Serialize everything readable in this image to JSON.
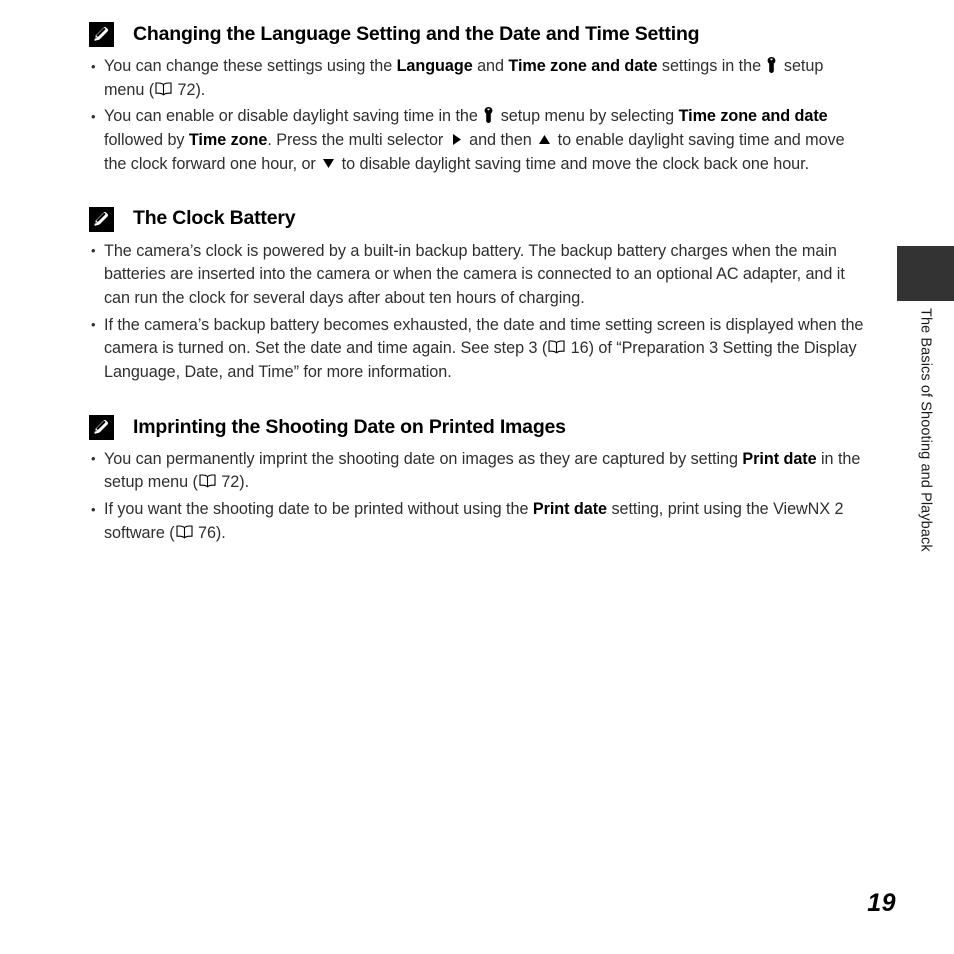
{
  "page": {
    "number": "19",
    "side_tab_label": "The Basics of Shooting and Playback"
  },
  "icons": {
    "note": "pencil-note-icon",
    "setup_menu": "wrench-icon",
    "page_reference": "open-book-icon",
    "multi_selector_right": "triangle-right-icon",
    "multi_selector_up": "triangle-up-icon",
    "multi_selector_down": "triangle-down-icon"
  },
  "sections": [
    {
      "id": "language-date-time",
      "title": "Changing the Language Setting and the Date and Time Setting",
      "bullets": [
        {
          "id": "change-settings",
          "parts": [
            {
              "t": "You can change these settings using the "
            },
            {
              "t": "Language",
              "b": true
            },
            {
              "t": " and "
            },
            {
              "t": "Time zone and date",
              "b": true
            },
            {
              "t": " settings in the "
            },
            {
              "icon": "wrench"
            },
            {
              "t": " setup menu ("
            },
            {
              "icon": "book"
            },
            {
              "t": " 72)."
            }
          ]
        },
        {
          "id": "daylight-saving",
          "parts": [
            {
              "t": "You can enable or disable daylight saving time in the "
            },
            {
              "icon": "wrench"
            },
            {
              "t": " setup menu by selecting "
            },
            {
              "t": "Time zone and date",
              "b": true
            },
            {
              "t": " followed by "
            },
            {
              "t": "Time zone",
              "b": true
            },
            {
              "t": ". Press the multi selector "
            },
            {
              "icon": "tri-right"
            },
            {
              "t": " and then "
            },
            {
              "icon": "tri-up"
            },
            {
              "t": " to enable daylight saving time and move the clock forward one hour, or "
            },
            {
              "icon": "tri-down"
            },
            {
              "t": " to disable daylight saving time and move the clock back one hour."
            }
          ]
        }
      ]
    },
    {
      "id": "clock-battery",
      "title": "The Clock Battery",
      "bullets": [
        {
          "id": "backup-battery",
          "parts": [
            {
              "t": "The camera’s clock is powered by a built-in backup battery. The backup battery charges when the main batteries are inserted into the camera or when the camera is connected to an optional AC adapter, and it can run the clock for several days after about ten hours of charging."
            }
          ]
        },
        {
          "id": "exhausted-battery",
          "parts": [
            {
              "t": "If the camera’s backup battery becomes exhausted, the date and time setting screen is displayed when the camera is turned on. Set the date and time again. See step 3 ("
            },
            {
              "icon": "book"
            },
            {
              "t": " 16) of “Preparation 3 Setting the Display Language, Date, and Time” for more information."
            }
          ]
        }
      ]
    },
    {
      "id": "imprinting-shooting-date",
      "title": "Imprinting the Shooting Date on Printed Images",
      "bullets": [
        {
          "id": "print-date-setting",
          "parts": [
            {
              "t": "You can permanently imprint the shooting date on images as they are captured by setting "
            },
            {
              "t": "Print date",
              "b": true
            },
            {
              "t": " in the setup menu ("
            },
            {
              "icon": "book"
            },
            {
              "t": " 72)."
            }
          ]
        },
        {
          "id": "viewnx-print",
          "parts": [
            {
              "t": "If you want the shooting date to be printed without using the "
            },
            {
              "t": "Print date",
              "b": true
            },
            {
              "t": " setting, print using the ViewNX 2 software ("
            },
            {
              "icon": "book"
            },
            {
              "t": " 76)."
            }
          ]
        }
      ]
    }
  ],
  "colors": {
    "body_text": "#2f2f2f",
    "heading_text": "#000000",
    "side_tab": "#333333",
    "background": "#ffffff"
  }
}
